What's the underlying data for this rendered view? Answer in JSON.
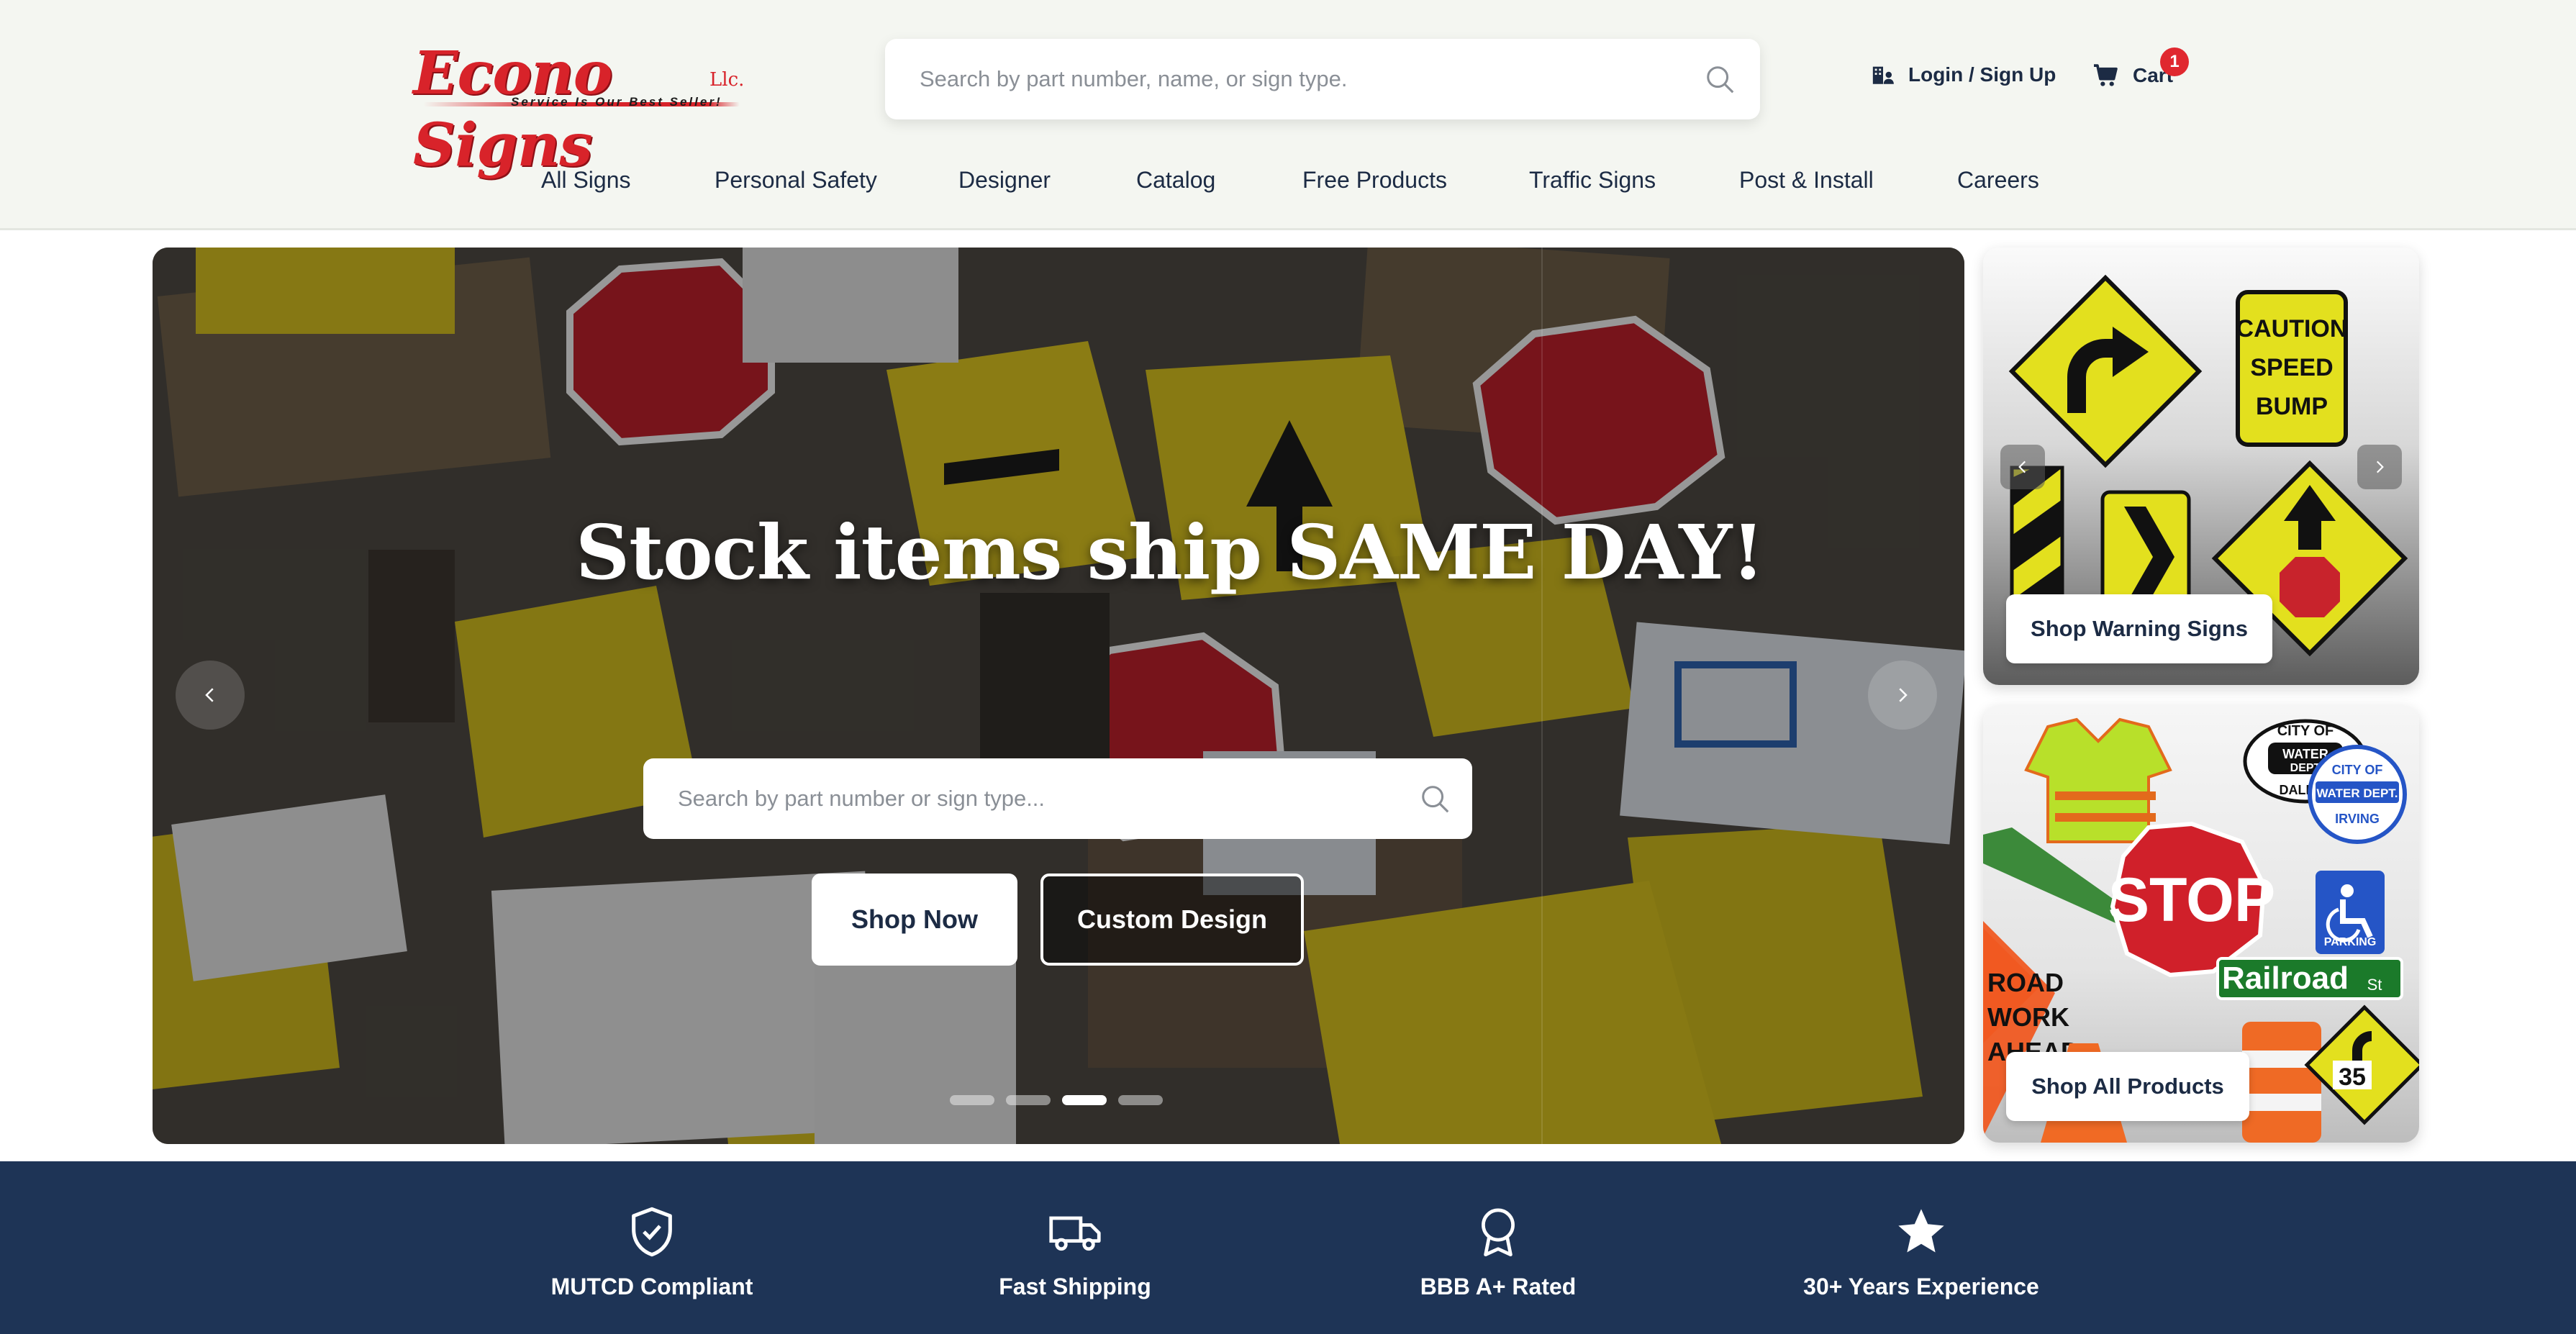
{
  "brand": {
    "name": "Econo Signs",
    "suffix": "Llc.",
    "tagline": "Service Is Our Best Seller!",
    "primary_color": "#d8232a",
    "navy": "#1e3456"
  },
  "header": {
    "search_placeholder": "Search by part number, name, or sign type.",
    "login_label": "Login / Sign Up",
    "cart_label": "Cart",
    "cart_count": "1"
  },
  "nav": {
    "items": [
      {
        "label": "All Signs"
      },
      {
        "label": "Personal Safety"
      },
      {
        "label": "Designer"
      },
      {
        "label": "Catalog"
      },
      {
        "label": "Free Products"
      },
      {
        "label": "Traffic Signs"
      },
      {
        "label": "Post & Install"
      },
      {
        "label": "Careers"
      }
    ]
  },
  "hero": {
    "title": "Stock items ship SAME DAY!",
    "search_placeholder": "Search by part number or sign type...",
    "shop_now_label": "Shop Now",
    "custom_design_label": "Custom Design",
    "slide_count": 4,
    "active_slide": 3
  },
  "side_cards": {
    "warning": {
      "button_label": "Shop Warning Signs",
      "caution_sign_text": [
        "CAUTION",
        "SPEED",
        "BUMP"
      ]
    },
    "all_products": {
      "button_label": "Shop All Products",
      "stop_text": "STOP",
      "street_sign_text": "Railroad",
      "street_suffix": "St",
      "parking_text": "PARKING",
      "speed_text": "35",
      "badge_text": [
        "CITY OF",
        "WATER",
        "DEPT",
        "DALLAS"
      ],
      "badge2_text": [
        "CITY OF",
        "WATER DEPT.",
        "IRVING"
      ],
      "road_work_text": [
        "ROAD",
        "WORK",
        "AHEAD"
      ]
    }
  },
  "features": [
    {
      "icon": "shield-check-icon",
      "label": "MUTCD Compliant"
    },
    {
      "icon": "truck-icon",
      "label": "Fast Shipping"
    },
    {
      "icon": "award-ribbon-icon",
      "label": "BBB A+ Rated"
    },
    {
      "icon": "star-icon",
      "label": "30+ Years Experience"
    }
  ]
}
